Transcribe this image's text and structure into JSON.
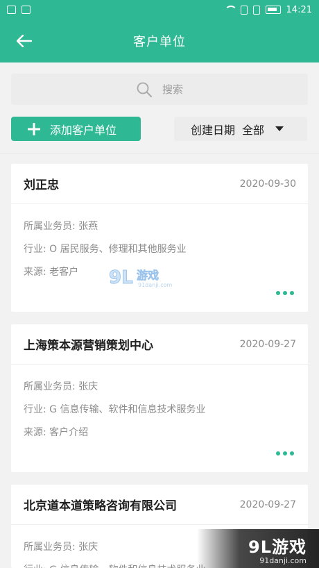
{
  "status_bar": {
    "time": "14:21",
    "icons": [
      "trash-icon",
      "image-icon",
      "wifi-icon",
      "sim-icon",
      "sim-icon",
      "battery-icon"
    ]
  },
  "app_bar": {
    "title": "客户单位",
    "back_icon": "arrow-left-icon"
  },
  "search": {
    "placeholder": "搜索",
    "icon": "search-icon"
  },
  "toolbar": {
    "add_label": "添加客户单位",
    "filter_label": "创建日期",
    "filter_value": "全部"
  },
  "customers": [
    {
      "name": "刘正忠",
      "date": "2020-09-30",
      "salesperson": "所属业务员: 张燕",
      "industry": "行业: O 居民服务、修理和其他服务业",
      "source": "来源: 老客户"
    },
    {
      "name": "上海策本源营销策划中心",
      "date": "2020-09-27",
      "salesperson": "所属业务员: 张庆",
      "industry": "行业: G 信息传输、软件和信息技术服务业",
      "source": "来源: 客户介绍"
    },
    {
      "name": "北京道本道策略咨询有限公司",
      "date": "2020-09-27",
      "salesperson": "所属业务员: 张庆",
      "industry": "行业: G 信息传输、软件和信息技术服务业"
    }
  ],
  "watermark": {
    "brand": "9L游戏",
    "site": "91danji.com"
  },
  "colors": {
    "accent": "#2eb894",
    "background": "#f2f2f2"
  }
}
